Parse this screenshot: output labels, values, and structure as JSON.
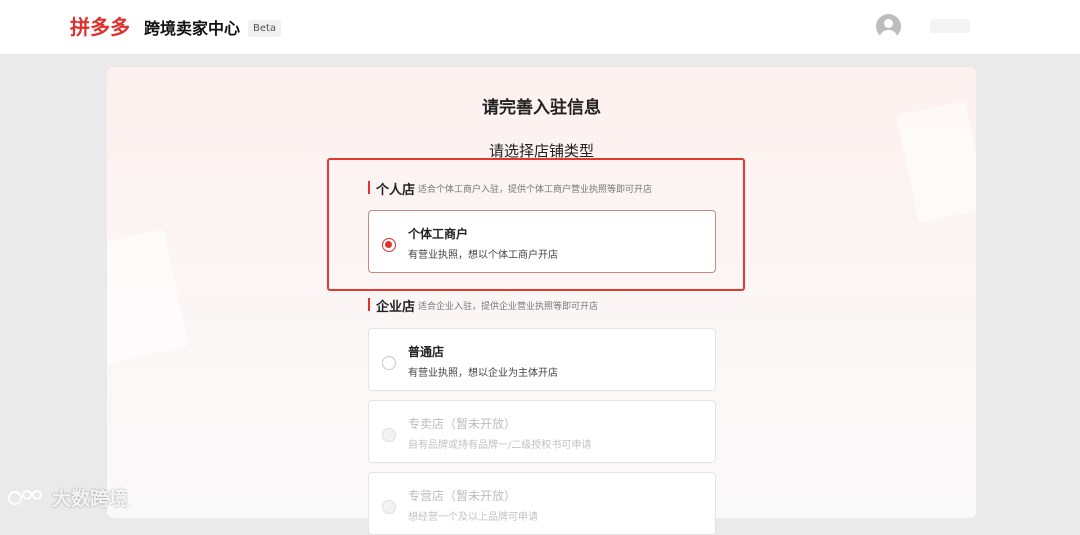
{
  "header": {
    "brand": "拼多多",
    "center_title": "跨境卖家中心",
    "beta_badge": "Beta"
  },
  "page": {
    "title": "请完善入驻信息",
    "subtitle": "请选择店铺类型"
  },
  "sections": [
    {
      "name": "个人店",
      "description": "适合个体工商户入驻，提供个体工商户营业执照等即可开店",
      "options": [
        {
          "title": "个体工商户",
          "description": "有营业执照，想以个体工商户开店",
          "state": "selected"
        }
      ]
    },
    {
      "name": "企业店",
      "description": "适合企业入驻，提供企业营业执照等即可开店",
      "options": [
        {
          "title": "普通店",
          "description": "有营业执照，想以企业为主体开店",
          "state": "unselected"
        },
        {
          "title": "专卖店（暂未开放）",
          "description": "自有品牌或持有品牌一/二级授权书可申请",
          "state": "disabled"
        },
        {
          "title": "专营店（暂未开放）",
          "description": "想经营一个及以上品牌可申请",
          "state": "disabled"
        }
      ]
    }
  ],
  "watermark": "大数跨境",
  "colors": {
    "accent": "#e0312d",
    "highlight_border": "#e03a2e",
    "background": "#eaeaea"
  }
}
